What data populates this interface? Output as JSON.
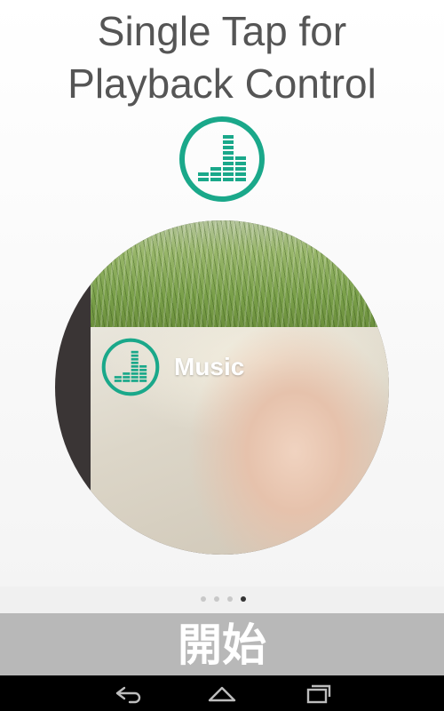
{
  "title": {
    "line1": "Single Tap for",
    "line2": "Playback Control"
  },
  "hero_icon": "equalizer-icon",
  "tile": {
    "label": "Music",
    "icon": "equalizer-icon"
  },
  "pager": {
    "count": 4,
    "active_index": 3
  },
  "start_button": {
    "label": "開始"
  },
  "navbar": {
    "back_icon": "back-icon",
    "home_icon": "home-icon",
    "recents_icon": "recent-apps-icon"
  },
  "colors": {
    "accent": "#1aa88a",
    "title_text": "#555555",
    "start_bg": "#b8b8b8"
  }
}
